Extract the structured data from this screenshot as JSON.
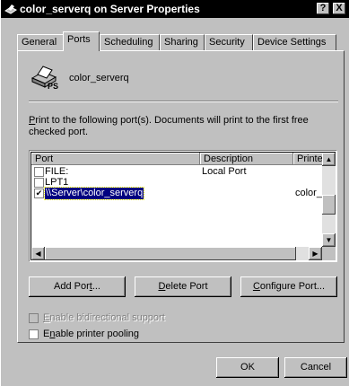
{
  "window": {
    "title": "color_serverq on Server Properties",
    "help_label": "?",
    "close_label": "X",
    "icon": "printer-icon"
  },
  "tabs": [
    {
      "label": "General"
    },
    {
      "label": "Ports"
    },
    {
      "label": "Scheduling"
    },
    {
      "label": "Sharing"
    },
    {
      "label": "Security"
    },
    {
      "label": "Device Settings"
    }
  ],
  "active_tab": "Ports",
  "printer": {
    "name": "color_serverq",
    "icon_badge": "PS"
  },
  "instructions": {
    "first_char": "P",
    "rest": "rint to the following port(s).  Documents will print to the first free checked port."
  },
  "port_list": {
    "columns": [
      "Port",
      "Description",
      "Printer"
    ],
    "rows": [
      {
        "port": "FILE:",
        "description": "Local Port",
        "printer": "",
        "checked": false,
        "selected": false
      },
      {
        "port": "LPT1",
        "description": "",
        "printer": "",
        "checked": false,
        "selected": false
      },
      {
        "port": "\\\\Server\\color_serverq",
        "description": "",
        "printer": "color_se",
        "checked": true,
        "selected": true
      }
    ]
  },
  "buttons": {
    "add_port_a": "Add Por",
    "add_port_u": "t",
    "add_port_b": "...",
    "delete_port_u": "D",
    "delete_port_b": "elete Port",
    "configure_port_u": "C",
    "configure_port_b": "onfigure Port...",
    "ok": "OK",
    "cancel": "Cancel"
  },
  "options": {
    "bidirectional_u": "E",
    "bidirectional_b": "nable bidirectional support",
    "bidirectional_enabled": false,
    "pooling_a": "E",
    "pooling_u": "n",
    "pooling_b": "able printer pooling",
    "pooling_checked": false
  }
}
